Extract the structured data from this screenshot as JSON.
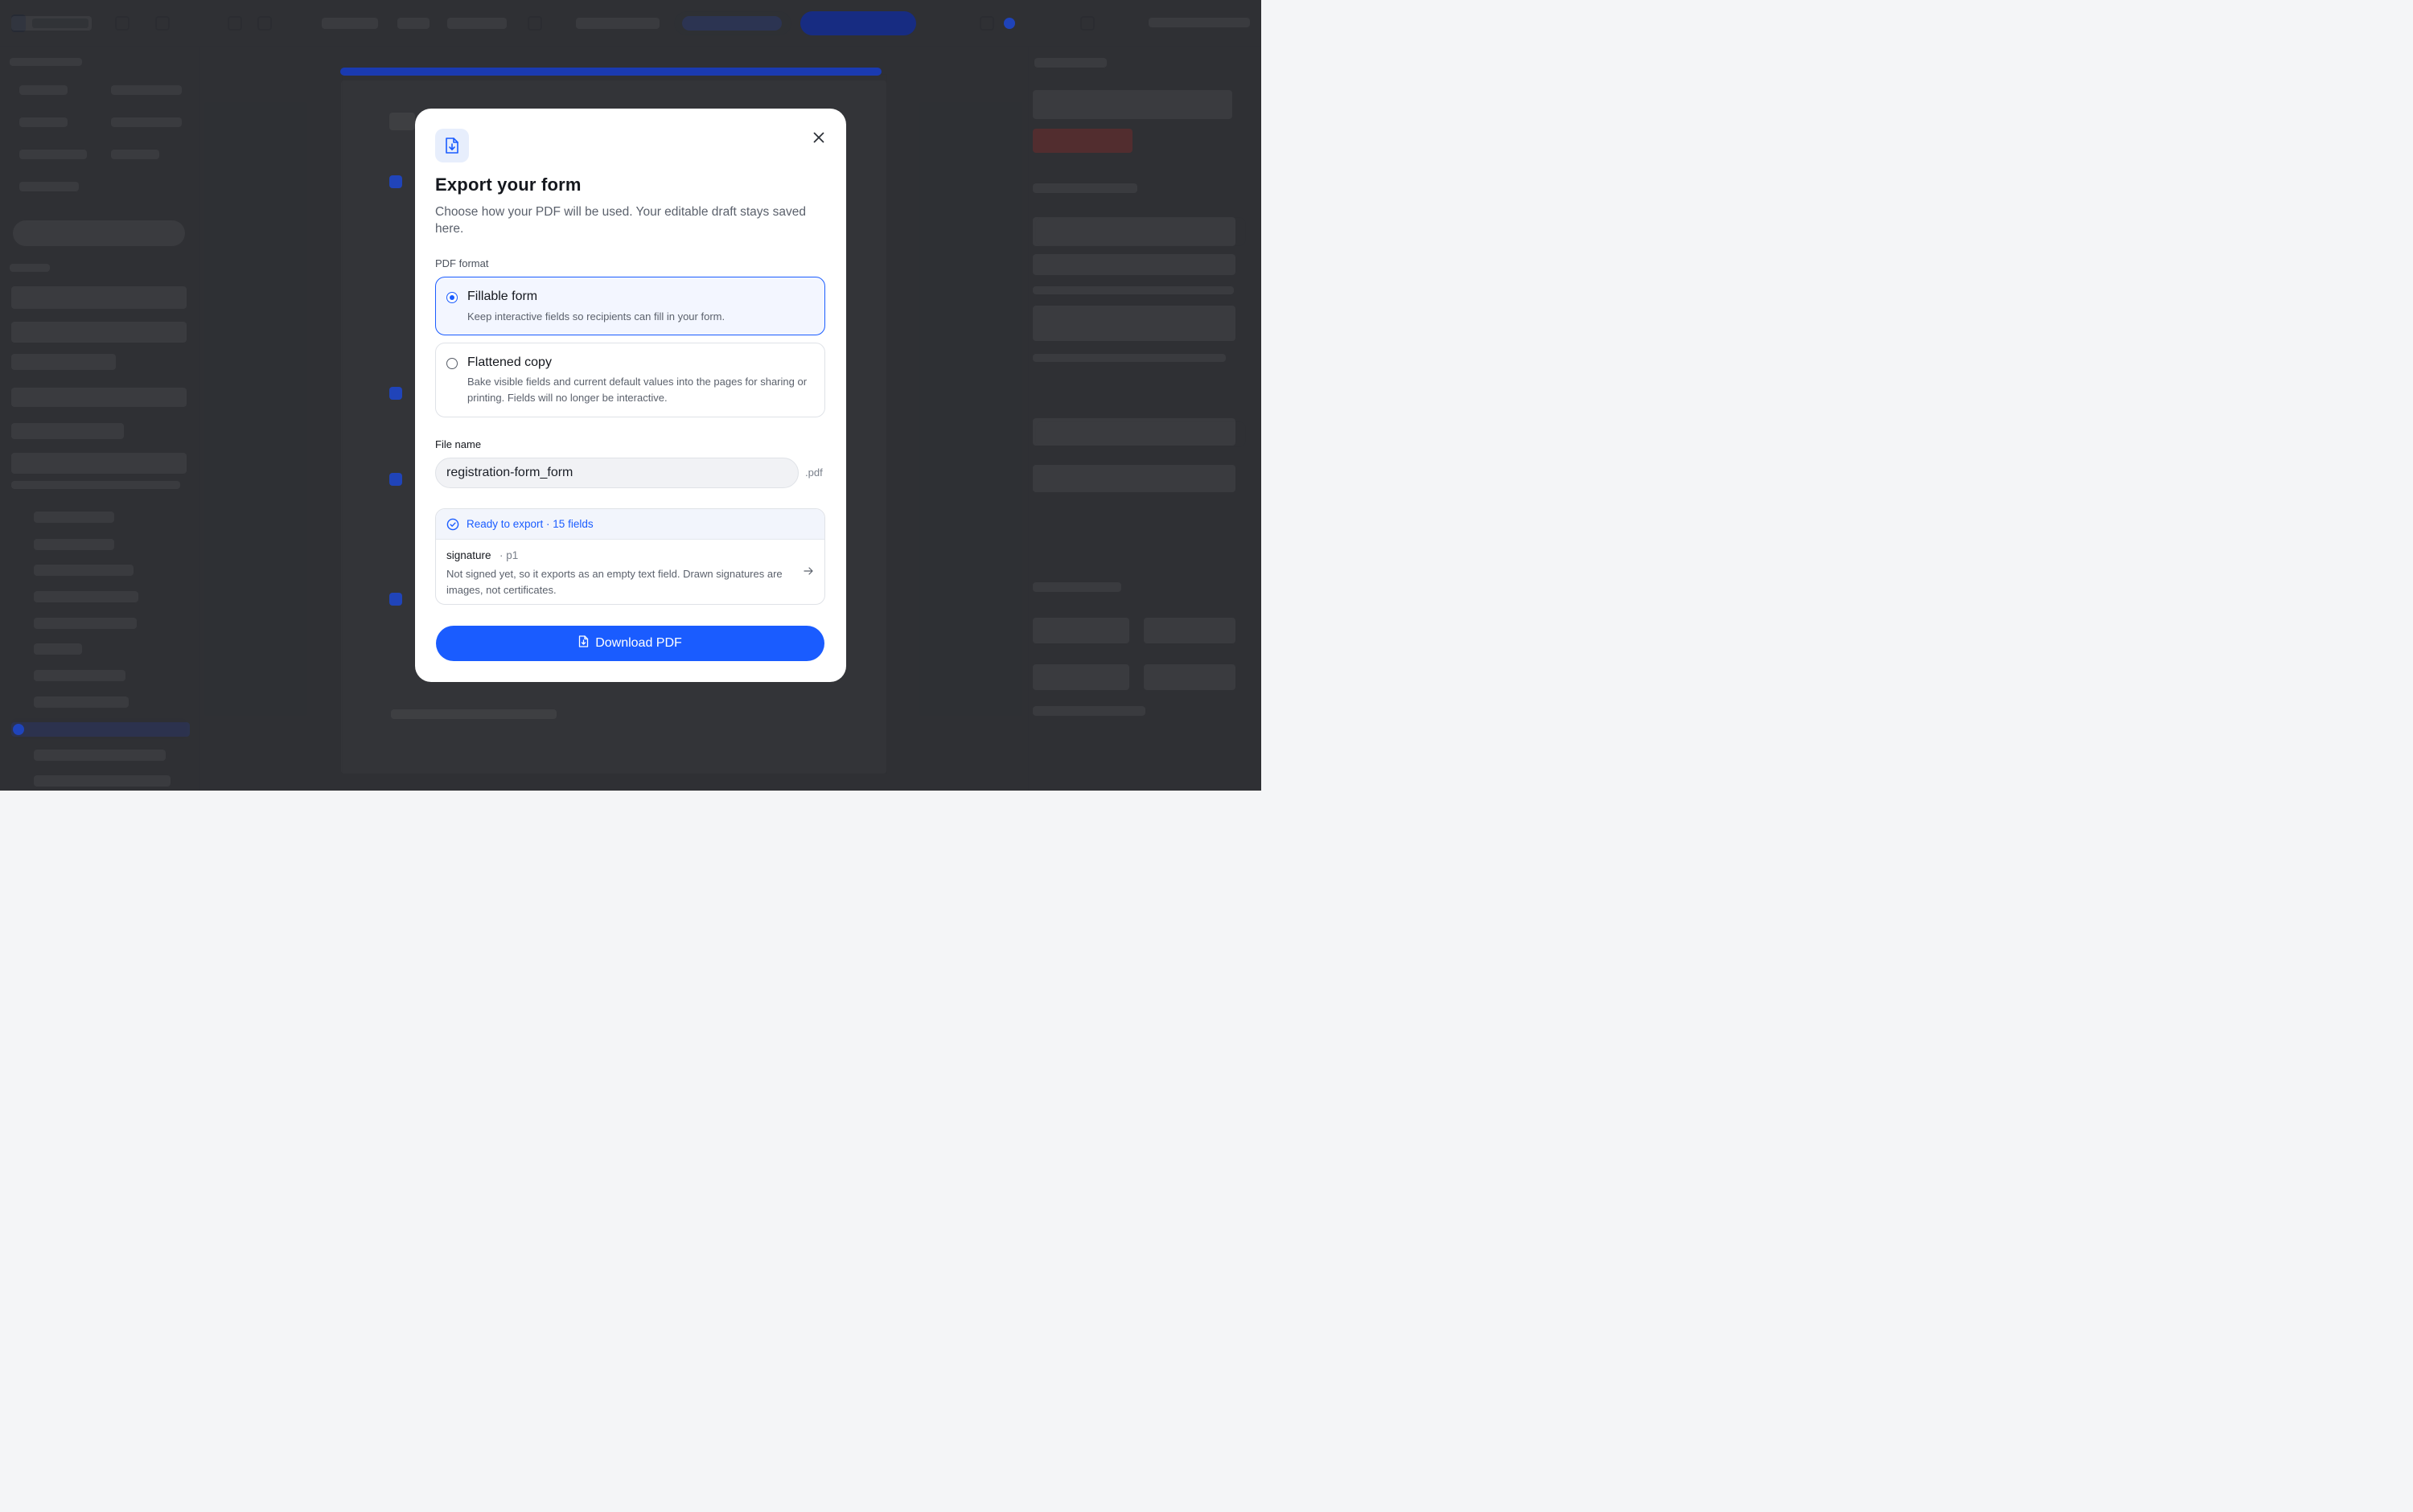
{
  "modal": {
    "title": "Export your form",
    "subtitle": "Choose how your PDF will be used. Your editable draft stays saved here.",
    "format_label": "PDF format",
    "options": [
      {
        "title": "Fillable form",
        "description": "Keep interactive fields so recipients can fill in your form.",
        "selected": true
      },
      {
        "title": "Flattened copy",
        "description": "Bake visible fields and current default values into the pages for sharing or printing. Fields will no longer be interactive.",
        "selected": false
      }
    ],
    "file_name_label": "File name",
    "file_name_value": "registration-form_form",
    "file_extension": ".pdf",
    "status": {
      "ready_text": "Ready to export · 15 fields",
      "issue_field": "signature",
      "issue_page": "· p1",
      "issue_description": "Not signed yet, so it exports as an empty text field. Drawn signatures are images, not certificates."
    },
    "download_label": "Download PDF"
  },
  "colors": {
    "accent": "#1a5cff",
    "accent_light": "#e7eefc",
    "overlay": "#26282c"
  },
  "icons": {
    "header": "file-download-icon",
    "close": "close-icon",
    "ready": "check-circle-icon",
    "issue": "arrow-right-icon",
    "download": "file-download-icon"
  }
}
